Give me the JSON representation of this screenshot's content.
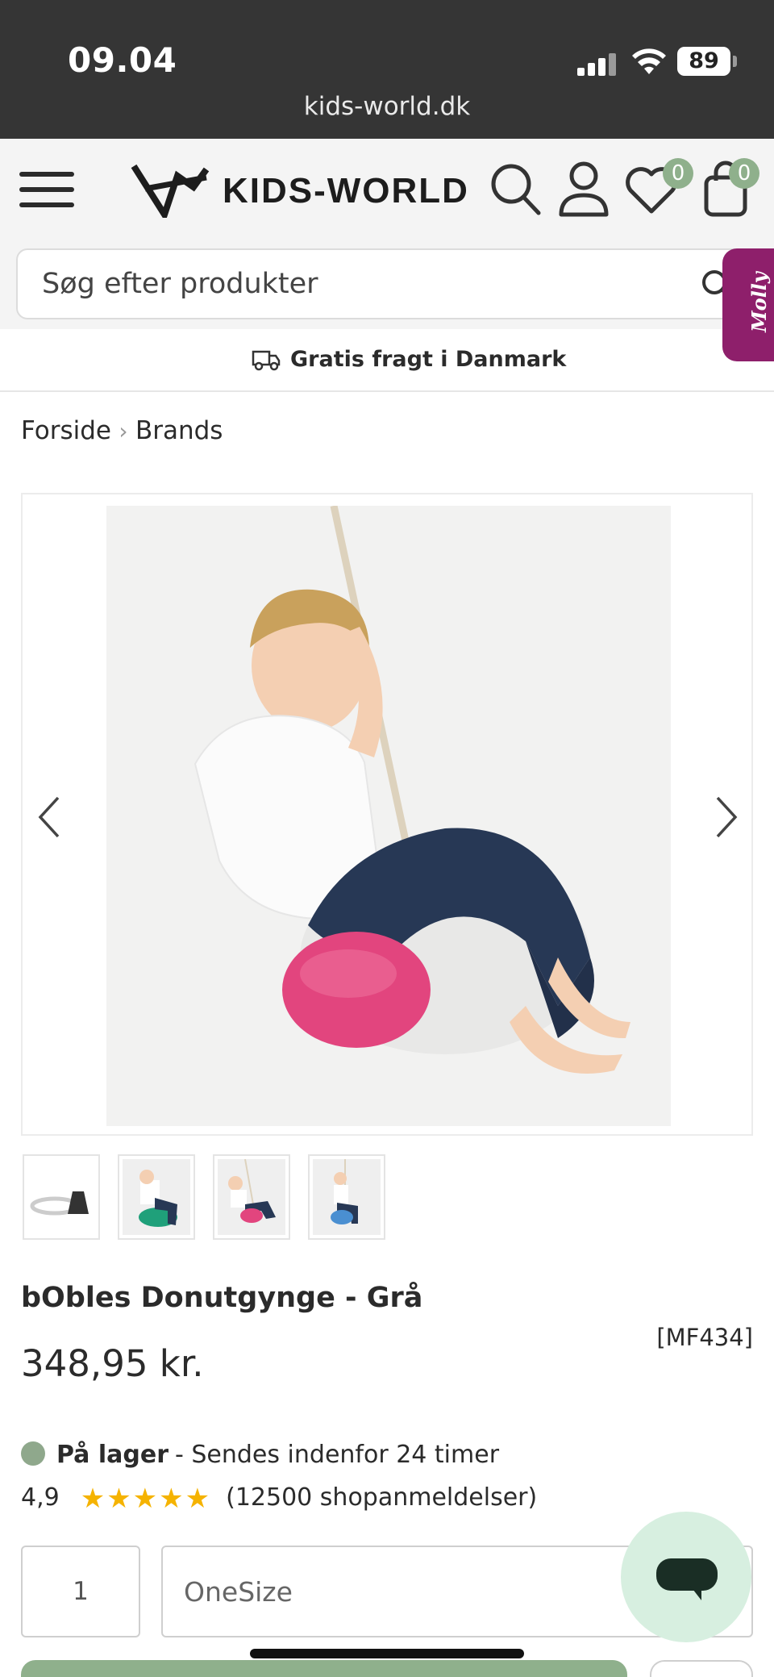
{
  "status_bar": {
    "time": "09.04",
    "url": "kids-world.dk",
    "battery": "89"
  },
  "header": {
    "logo_text": "KIDS-WORLD",
    "wishlist_count": "0",
    "cart_count": "0"
  },
  "search": {
    "placeholder": "Søg efter produkter"
  },
  "assistant": {
    "label": "Molly"
  },
  "shipping": {
    "text": "Gratis fragt i Danmark"
  },
  "breadcrumb": {
    "items": [
      "Forside",
      "Brands"
    ],
    "separator": "›"
  },
  "product": {
    "title": "bObles Donutgynge - Grå",
    "sku": "[MF434]",
    "price": "348,95 kr.",
    "stock_status": "På lager",
    "stock_detail": "- Sendes indenfor 24 timer",
    "rating_value": "4,9",
    "rating_stars": "★★★★★",
    "review_count": "(12500 shopanmeldelser)",
    "quantity": "1",
    "size": "OneSize"
  },
  "colors": {
    "brand_green": "#8fb08c",
    "status_bar": "#353535",
    "molly_purple": "#8e1f6b",
    "star_yellow": "#f5b301",
    "swing_pink": "#e2457e"
  }
}
